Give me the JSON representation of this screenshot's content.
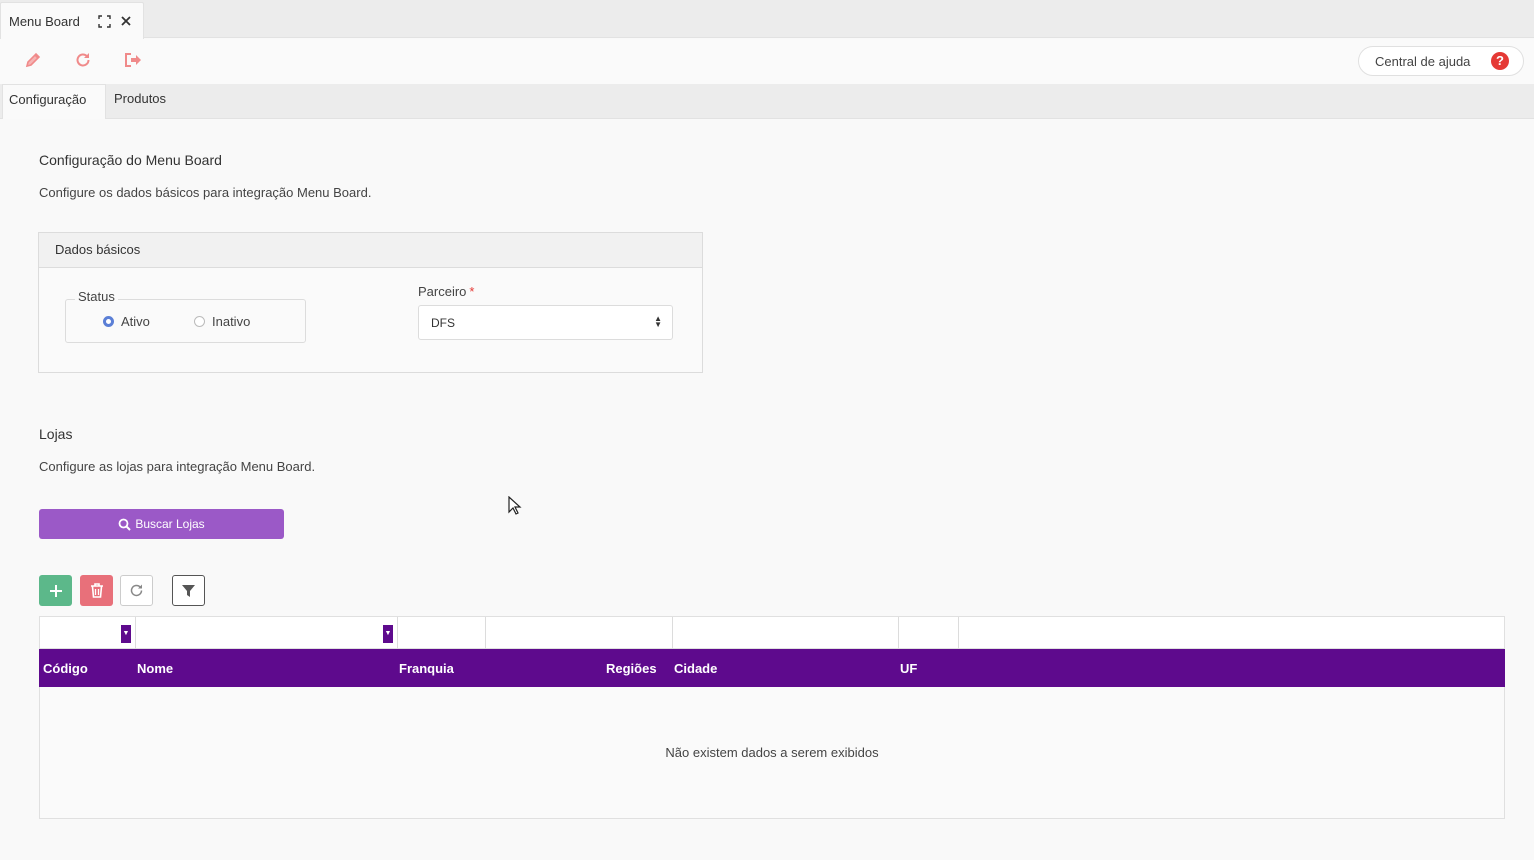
{
  "window": {
    "tab_title": "Menu Board"
  },
  "toolbar": {
    "icons": [
      "pencil-icon",
      "refresh-icon",
      "exit-icon"
    ],
    "help_label": "Central de ajuda",
    "help_glyph": "?"
  },
  "tabs": [
    {
      "label": "Configuração",
      "active": true
    },
    {
      "label": "Produtos",
      "active": false
    }
  ],
  "config_section": {
    "title": "Configuração do Menu Board",
    "description": "Configure os dados básicos para integração Menu Board."
  },
  "basic_data": {
    "header": "Dados básicos",
    "status_label": "Status",
    "status_options": [
      "Ativo",
      "Inativo"
    ],
    "status_selected": "Ativo",
    "partner_label": "Parceiro",
    "partner_required_mark": "*",
    "partner_value": "DFS"
  },
  "stores_section": {
    "title": "Lojas",
    "description": "Configure as lojas para integração Menu Board.",
    "search_button": "Buscar Lojas"
  },
  "grid": {
    "columns": [
      "Código",
      "Nome",
      "Franquia",
      "Regiões",
      "Cidade",
      "UF"
    ],
    "empty_message": "Não existem dados a serem exibidos"
  },
  "colors": {
    "grid_header": "#5e0a8d",
    "search_button": "#9b59c7",
    "add_button": "#5cb88a",
    "delete_button": "#e8707a",
    "help_icon": "#e53935",
    "toolbar_icon": "#f08a8a"
  }
}
